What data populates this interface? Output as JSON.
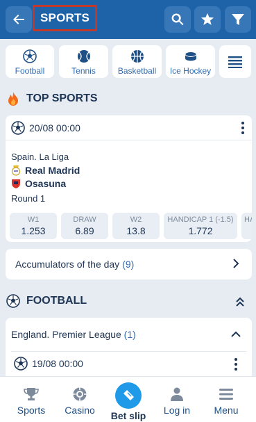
{
  "header": {
    "title": "SPORTS"
  },
  "sport_tabs": [
    {
      "label": "Football",
      "icon": "football-icon"
    },
    {
      "label": "Tennis",
      "icon": "tennis-icon"
    },
    {
      "label": "Basketball",
      "icon": "basketball-icon"
    },
    {
      "label": "Ice Hockey",
      "icon": "ice-hockey-icon"
    }
  ],
  "top_sports": {
    "title": "TOP SPORTS",
    "match": {
      "datetime": "20/08 00:00",
      "league": "Spain. La Liga",
      "home_team": "Real Madrid",
      "away_team": "Osasuna",
      "round": "Round 1",
      "odds": [
        {
          "label": "W1",
          "value": "1.253"
        },
        {
          "label": "DRAW",
          "value": "6.89"
        },
        {
          "label": "W2",
          "value": "13.8"
        },
        {
          "label": "HANDICAP 1 (-1.5)",
          "value": "1.772"
        },
        {
          "label": "HA",
          "value": ""
        }
      ]
    },
    "accumulators": {
      "label": "Accumulators of the day",
      "count": "(9)"
    }
  },
  "football": {
    "title": "FOOTBALL",
    "league_row": {
      "label": "England. Premier League",
      "count": "(1)"
    },
    "match": {
      "datetime": "19/08 00:00"
    }
  },
  "bottom_nav": {
    "sports": "Sports",
    "casino": "Casino",
    "betslip": "Bet slip",
    "login": "Log in",
    "menu": "Menu"
  },
  "colors": {
    "header_bg": "#1e63a8",
    "accent": "#2f6bb0",
    "betslip_bubble": "#1e9ae8",
    "highlight_border": "#c0392b"
  }
}
